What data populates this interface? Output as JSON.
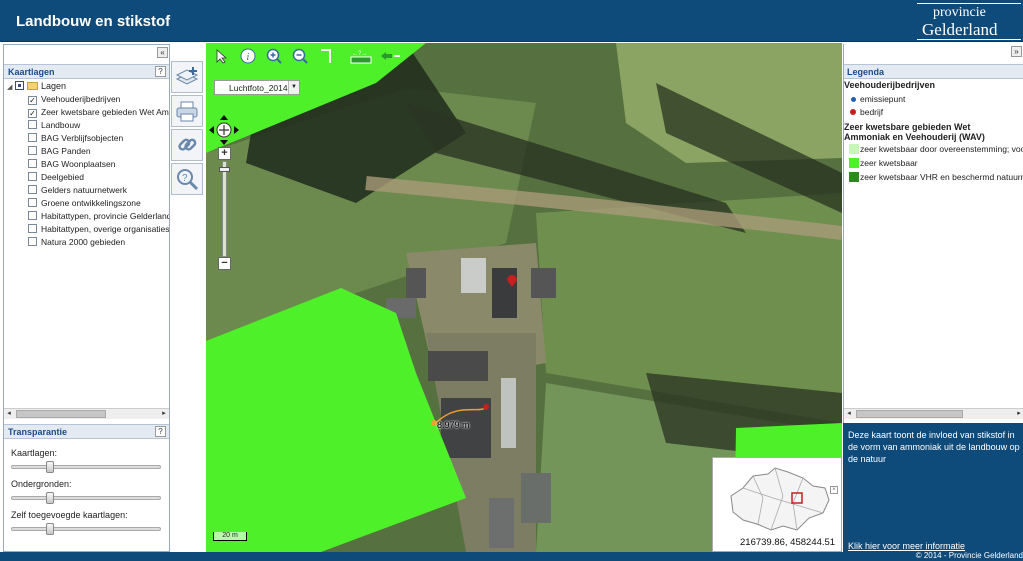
{
  "header": {
    "title": "Landbouw en stikstof"
  },
  "logo": {
    "line1": "provincie",
    "line2": "Gelderland"
  },
  "left_panel": {
    "collapse_glyph": "«",
    "layers_title": "Kaartlagen",
    "help": "?",
    "root_label": "Lagen",
    "layers": [
      {
        "label": "Veehouderijbedrijven",
        "checked": true
      },
      {
        "label": "Zeer kwetsbare gebieden Wet Ammoniak en Veehouderij",
        "checked": true
      },
      {
        "label": "Landbouw",
        "checked": false
      },
      {
        "label": "BAG Verblijfsobjecten",
        "checked": false
      },
      {
        "label": "BAG Panden",
        "checked": false
      },
      {
        "label": "BAG Woonplaatsen",
        "checked": false
      },
      {
        "label": "Deelgebied",
        "checked": false
      },
      {
        "label": "Gelders natuurnetwerk",
        "checked": false
      },
      {
        "label": "Groene ontwikkelingszone",
        "checked": false
      },
      {
        "label": "Habitattypen, provincie Gelderland",
        "checked": false
      },
      {
        "label": "Habitattypen, overige organisaties",
        "checked": false
      },
      {
        "label": "Natura 2000 gebieden",
        "checked": false
      }
    ],
    "transparency_title": "Transparantie",
    "sliders": [
      {
        "label": "Kaartlagen:",
        "value": 0.25
      },
      {
        "label": "Ondergronden:",
        "value": 0.25
      },
      {
        "label": "Zelf toegevoegde kaartlagen:",
        "value": 0.25
      }
    ]
  },
  "tools": [
    "add-layer-icon",
    "print-icon",
    "link-icon",
    "search-icon"
  ],
  "map": {
    "basemap": "Luchtfoto_2014",
    "measure": "8.979 m",
    "scale": "20 m",
    "coords": "216739.86, 458244.51",
    "zoom_in": "+",
    "zoom_out": "−",
    "overview_close": "×",
    "toolbar_icons": [
      "select-arrow-icon",
      "info-icon",
      "zoom-in-icon",
      "zoom-out-icon",
      "measure-icon",
      "scale-icon",
      "navigate-back-icon"
    ]
  },
  "legend": {
    "collapse_glyph": "»",
    "title": "Legenda",
    "group1": "Veehouderijbedrijven",
    "g1_items": [
      {
        "label": "emissiepunt",
        "color": "#1f5fb0"
      },
      {
        "label": "bedrijf",
        "color": "#c81e1e"
      }
    ],
    "group2_line1": "Zeer kwetsbare gebieden Wet",
    "group2_line2": "Ammoniak en Veehouderij (WAV)",
    "g2_items": [
      {
        "label": "zeer kwetsbaar door overeenstemming; voorlopig",
        "color": "#c8f5b8"
      },
      {
        "label": "zeer kwetsbaar",
        "color": "#4ef02a"
      },
      {
        "label": "zeer kwetsbaar VHR en beschermd natuurmonument",
        "color": "#2e8a1c"
      }
    ]
  },
  "info": {
    "text": "Deze kaart toont de invloed van stikstof in de vorm van ammoniak uit de landbouw op de natuur",
    "link": "Klik hier voor meer informatie"
  },
  "footer": {
    "copyright": "© 2014 - Provincie Gelderland"
  },
  "colors": {
    "brand": "#0e4a7a",
    "wav_green": "#4ef02a",
    "bedrijf_red": "#c81e1e"
  }
}
